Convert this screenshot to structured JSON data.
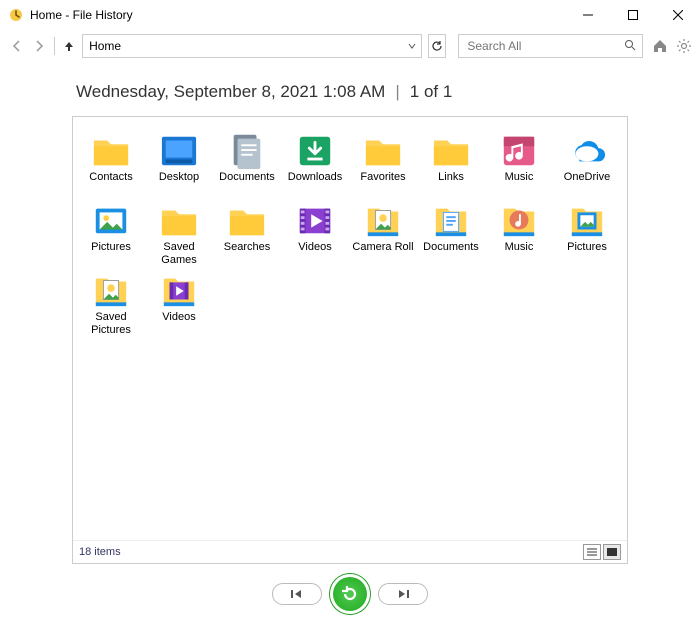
{
  "window": {
    "title": "Home - File History"
  },
  "nav": {
    "address_text": "Home",
    "search_placeholder": "Search All"
  },
  "snapshot": {
    "timestamp": "Wednesday, September 8, 2021 1:08 AM",
    "separator": "|",
    "page": "1 of 1"
  },
  "items": [
    {
      "name": "Contacts",
      "icon": "folder"
    },
    {
      "name": "Desktop",
      "icon": "desktop"
    },
    {
      "name": "Documents",
      "icon": "documents"
    },
    {
      "name": "Downloads",
      "icon": "downloads"
    },
    {
      "name": "Favorites",
      "icon": "folder"
    },
    {
      "name": "Links",
      "icon": "folder"
    },
    {
      "name": "Music",
      "icon": "music"
    },
    {
      "name": "OneDrive",
      "icon": "onedrive"
    },
    {
      "name": "Pictures",
      "icon": "pictures"
    },
    {
      "name": "Saved Games",
      "icon": "folder"
    },
    {
      "name": "Searches",
      "icon": "folder"
    },
    {
      "name": "Videos",
      "icon": "videos"
    },
    {
      "name": "Camera Roll",
      "icon": "lib-camera"
    },
    {
      "name": "Documents",
      "icon": "lib-documents"
    },
    {
      "name": "Music",
      "icon": "lib-music"
    },
    {
      "name": "Pictures",
      "icon": "lib-pictures"
    },
    {
      "name": "Saved Pictures",
      "icon": "lib-camera"
    },
    {
      "name": "Videos",
      "icon": "lib-videos"
    }
  ],
  "status": {
    "count_text": "18 items"
  }
}
